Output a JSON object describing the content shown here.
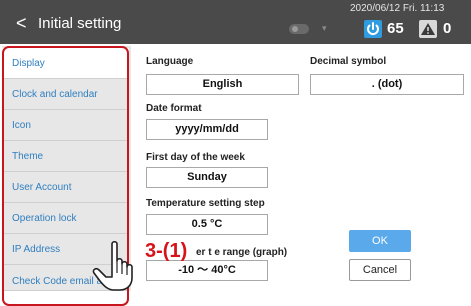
{
  "header": {
    "back_glyph": "<",
    "title": "Initial setting",
    "datetime": "2020/06/12 Fri. 11:13",
    "power_value": "65",
    "alert_value": "0",
    "icons": [
      "back-arrow-icon",
      "toggle-icon",
      "power-icon",
      "alert-icon"
    ]
  },
  "sidebar": {
    "items": [
      {
        "label": "Display",
        "active": true
      },
      {
        "label": "Clock and calendar",
        "active": false
      },
      {
        "label": "Icon",
        "active": false
      },
      {
        "label": "Theme",
        "active": false
      },
      {
        "label": "User Account",
        "active": false
      },
      {
        "label": "Operation lock",
        "active": false
      },
      {
        "label": "IP Address",
        "active": false
      },
      {
        "label": "Check Code email addr",
        "active": false
      }
    ]
  },
  "settings": {
    "language_label": "Language",
    "language_value": "English",
    "decimal_label": "Decimal symbol",
    "decimal_value": ". (dot)",
    "date_format_label": "Date format",
    "date_format_value": "yyyy/mm/dd",
    "first_day_label": "First day of the week",
    "first_day_value": "Sunday",
    "temp_step_label": "Temperature setting step",
    "temp_step_value": "0.5 °C",
    "temp_range_label": "er t e range (graph)",
    "temp_range_value": "-10 ～ 40°C"
  },
  "buttons": {
    "ok": "OK",
    "cancel": "Cancel"
  },
  "annotation": {
    "step": "3-(1)"
  },
  "colors": {
    "header_bg": "#4a4a4a",
    "accent": "#2f9be0",
    "highlight": "#c7161e",
    "ok_bg": "#5aa9ea",
    "sidebar_text": "#2f7fc1"
  }
}
